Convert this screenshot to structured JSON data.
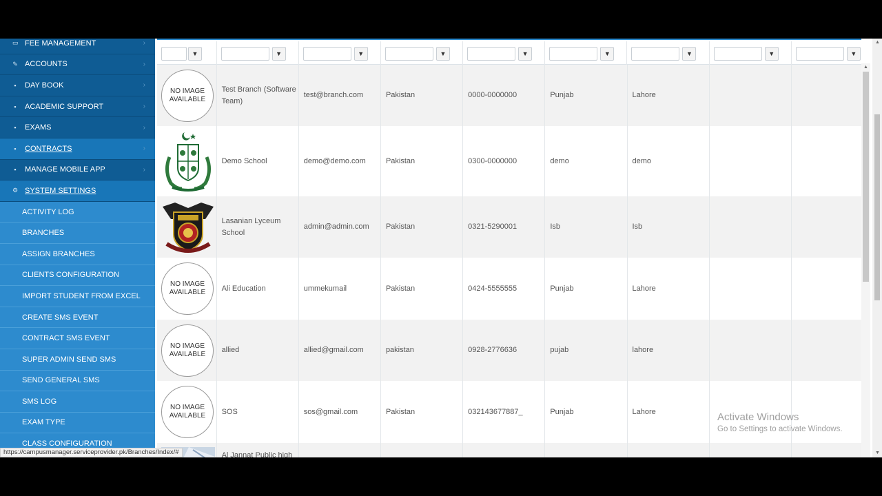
{
  "sidebar": {
    "top_items": [
      {
        "label": "FEE MANAGEMENT",
        "icon": "card-icon"
      },
      {
        "label": "ACCOUNTS",
        "icon": "wrench-icon"
      },
      {
        "label": "DAY BOOK",
        "icon": "grid-icon"
      },
      {
        "label": "ACADEMIC SUPPORT",
        "icon": "grid-icon"
      },
      {
        "label": "EXAMS",
        "icon": "grid-icon"
      },
      {
        "label": "CONTRACTS",
        "icon": "grid-icon"
      },
      {
        "label": "MANAGE MOBILE APP",
        "icon": "grid-icon"
      },
      {
        "label": "SYSTEM SETTINGS",
        "icon": "gear-icon"
      }
    ],
    "sub_items": [
      "ACTIVITY LOG",
      "BRANCHES",
      "ASSIGN BRANCHES",
      "CLIENTS CONFIGURATION",
      "IMPORT STUDENT FROM EXCEL",
      "CREATE SMS EVENT",
      "CONTRACT SMS EVENT",
      "SUPER ADMIN SEND SMS",
      "SEND GENERAL SMS",
      "SMS LOG",
      "EXAM TYPE",
      "CLASS CONFIGURATION"
    ]
  },
  "grid": {
    "no_image_text": "NO IMAGE AVAILABLE",
    "rows": [
      {
        "image": "none",
        "name": "Test Branch (Software Team)",
        "email": "test@branch.com",
        "country": "Pakistan",
        "phone": "0000-0000000",
        "province": "Punjab",
        "city": "Lahore"
      },
      {
        "image": "pakistan-emblem",
        "name": "Demo School",
        "email": "demo@demo.com",
        "country": "Pakistan",
        "phone": "0300-0000000",
        "province": "demo",
        "city": "demo"
      },
      {
        "image": "lasanian-crest",
        "name": "Lasanian Lyceum School",
        "email": "admin@admin.com",
        "country": "Pakistan",
        "phone": "0321-5290001",
        "province": "Isb",
        "city": "Isb"
      },
      {
        "image": "none",
        "name": "Ali Education",
        "email": "ummekumail",
        "country": "Pakistan",
        "phone": "0424-5555555",
        "province": "Punjab",
        "city": "Lahore"
      },
      {
        "image": "none",
        "name": "allied",
        "email": "allied@gmail.com",
        "country": "pakistan",
        "phone": "0928-2776636",
        "province": "pujab",
        "city": "lahore"
      },
      {
        "image": "none",
        "name": "SOS",
        "email": "sos@gmail.com",
        "country": "Pakistan",
        "phone": "032143677887_",
        "province": "Punjab",
        "city": "Lahore"
      },
      {
        "image": "photo",
        "name": "Al Jannat Public high",
        "email": "",
        "country": "",
        "phone": "",
        "province": "",
        "city": ""
      }
    ]
  },
  "status_url": "https://campusmanager.serviceprovider.pk/Branches/Index/#",
  "watermark": {
    "line1": "Activate Windows",
    "line2": "Go to Settings to activate Windows."
  },
  "colors": {
    "sidebar_top": "#0f5c94",
    "sidebar_sub": "#2d8bce",
    "row_alt": "#f2f2f2"
  }
}
